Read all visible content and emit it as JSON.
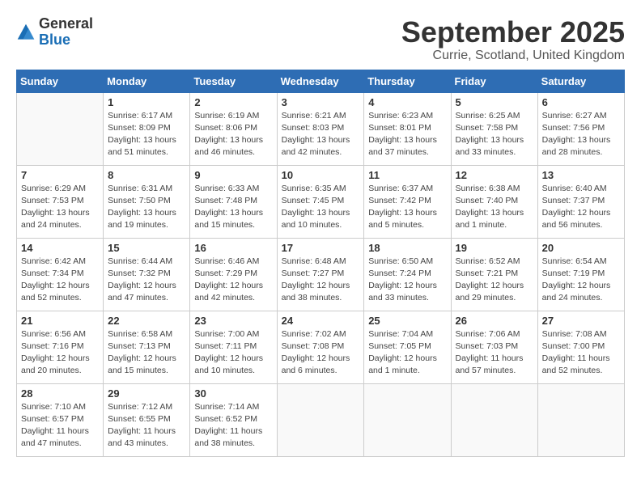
{
  "header": {
    "logo_general": "General",
    "logo_blue": "Blue",
    "title": "September 2025",
    "location": "Currie, Scotland, United Kingdom"
  },
  "weekdays": [
    "Sunday",
    "Monday",
    "Tuesday",
    "Wednesday",
    "Thursday",
    "Friday",
    "Saturday"
  ],
  "weeks": [
    [
      {
        "day": "",
        "info": ""
      },
      {
        "day": "1",
        "info": "Sunrise: 6:17 AM\nSunset: 8:09 PM\nDaylight: 13 hours\nand 51 minutes."
      },
      {
        "day": "2",
        "info": "Sunrise: 6:19 AM\nSunset: 8:06 PM\nDaylight: 13 hours\nand 46 minutes."
      },
      {
        "day": "3",
        "info": "Sunrise: 6:21 AM\nSunset: 8:03 PM\nDaylight: 13 hours\nand 42 minutes."
      },
      {
        "day": "4",
        "info": "Sunrise: 6:23 AM\nSunset: 8:01 PM\nDaylight: 13 hours\nand 37 minutes."
      },
      {
        "day": "5",
        "info": "Sunrise: 6:25 AM\nSunset: 7:58 PM\nDaylight: 13 hours\nand 33 minutes."
      },
      {
        "day": "6",
        "info": "Sunrise: 6:27 AM\nSunset: 7:56 PM\nDaylight: 13 hours\nand 28 minutes."
      }
    ],
    [
      {
        "day": "7",
        "info": "Sunrise: 6:29 AM\nSunset: 7:53 PM\nDaylight: 13 hours\nand 24 minutes."
      },
      {
        "day": "8",
        "info": "Sunrise: 6:31 AM\nSunset: 7:50 PM\nDaylight: 13 hours\nand 19 minutes."
      },
      {
        "day": "9",
        "info": "Sunrise: 6:33 AM\nSunset: 7:48 PM\nDaylight: 13 hours\nand 15 minutes."
      },
      {
        "day": "10",
        "info": "Sunrise: 6:35 AM\nSunset: 7:45 PM\nDaylight: 13 hours\nand 10 minutes."
      },
      {
        "day": "11",
        "info": "Sunrise: 6:37 AM\nSunset: 7:42 PM\nDaylight: 13 hours\nand 5 minutes."
      },
      {
        "day": "12",
        "info": "Sunrise: 6:38 AM\nSunset: 7:40 PM\nDaylight: 13 hours\nand 1 minute."
      },
      {
        "day": "13",
        "info": "Sunrise: 6:40 AM\nSunset: 7:37 PM\nDaylight: 12 hours\nand 56 minutes."
      }
    ],
    [
      {
        "day": "14",
        "info": "Sunrise: 6:42 AM\nSunset: 7:34 PM\nDaylight: 12 hours\nand 52 minutes."
      },
      {
        "day": "15",
        "info": "Sunrise: 6:44 AM\nSunset: 7:32 PM\nDaylight: 12 hours\nand 47 minutes."
      },
      {
        "day": "16",
        "info": "Sunrise: 6:46 AM\nSunset: 7:29 PM\nDaylight: 12 hours\nand 42 minutes."
      },
      {
        "day": "17",
        "info": "Sunrise: 6:48 AM\nSunset: 7:27 PM\nDaylight: 12 hours\nand 38 minutes."
      },
      {
        "day": "18",
        "info": "Sunrise: 6:50 AM\nSunset: 7:24 PM\nDaylight: 12 hours\nand 33 minutes."
      },
      {
        "day": "19",
        "info": "Sunrise: 6:52 AM\nSunset: 7:21 PM\nDaylight: 12 hours\nand 29 minutes."
      },
      {
        "day": "20",
        "info": "Sunrise: 6:54 AM\nSunset: 7:19 PM\nDaylight: 12 hours\nand 24 minutes."
      }
    ],
    [
      {
        "day": "21",
        "info": "Sunrise: 6:56 AM\nSunset: 7:16 PM\nDaylight: 12 hours\nand 20 minutes."
      },
      {
        "day": "22",
        "info": "Sunrise: 6:58 AM\nSunset: 7:13 PM\nDaylight: 12 hours\nand 15 minutes."
      },
      {
        "day": "23",
        "info": "Sunrise: 7:00 AM\nSunset: 7:11 PM\nDaylight: 12 hours\nand 10 minutes."
      },
      {
        "day": "24",
        "info": "Sunrise: 7:02 AM\nSunset: 7:08 PM\nDaylight: 12 hours\nand 6 minutes."
      },
      {
        "day": "25",
        "info": "Sunrise: 7:04 AM\nSunset: 7:05 PM\nDaylight: 12 hours\nand 1 minute."
      },
      {
        "day": "26",
        "info": "Sunrise: 7:06 AM\nSunset: 7:03 PM\nDaylight: 11 hours\nand 57 minutes."
      },
      {
        "day": "27",
        "info": "Sunrise: 7:08 AM\nSunset: 7:00 PM\nDaylight: 11 hours\nand 52 minutes."
      }
    ],
    [
      {
        "day": "28",
        "info": "Sunrise: 7:10 AM\nSunset: 6:57 PM\nDaylight: 11 hours\nand 47 minutes."
      },
      {
        "day": "29",
        "info": "Sunrise: 7:12 AM\nSunset: 6:55 PM\nDaylight: 11 hours\nand 43 minutes."
      },
      {
        "day": "30",
        "info": "Sunrise: 7:14 AM\nSunset: 6:52 PM\nDaylight: 11 hours\nand 38 minutes."
      },
      {
        "day": "",
        "info": ""
      },
      {
        "day": "",
        "info": ""
      },
      {
        "day": "",
        "info": ""
      },
      {
        "day": "",
        "info": ""
      }
    ]
  ]
}
